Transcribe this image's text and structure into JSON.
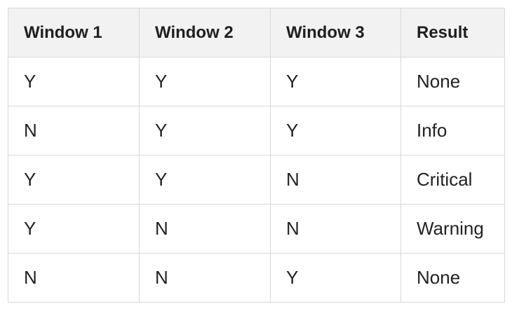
{
  "table": {
    "headers": [
      "Window 1",
      "Window 2",
      "Window 3",
      "Result"
    ],
    "rows": [
      [
        "Y",
        "Y",
        "Y",
        "None"
      ],
      [
        "N",
        "Y",
        "Y",
        "Info"
      ],
      [
        "Y",
        "Y",
        "N",
        "Critical"
      ],
      [
        "Y",
        "N",
        "N",
        "Warning"
      ],
      [
        "N",
        "N",
        "Y",
        "None"
      ]
    ]
  },
  "colors": {
    "header_bg": "#f2f2f2",
    "border": "#d9d9d9",
    "text": "#222222"
  }
}
